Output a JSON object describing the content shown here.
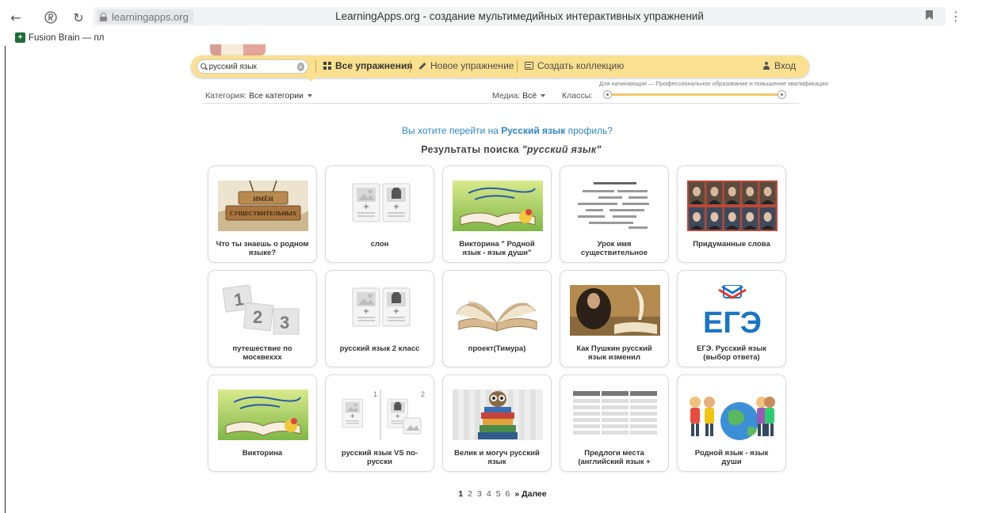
{
  "browser": {
    "url": "learningapps.org",
    "title": "LearningApps.org - создание мультимедийных интерактивных упражнений",
    "bookmark_label": "Fusion Brain — пл"
  },
  "header": {
    "search_value": "русский язык",
    "nav": {
      "all": "Все упражнения",
      "new": "Новое упражнение",
      "collection": "Создать коллекцию",
      "login": "Вход"
    }
  },
  "filters": {
    "category_label": "Категория:",
    "category_value": "Все категории",
    "media_label": "Медиа:",
    "media_value": "Всё",
    "grades_label": "Классы:",
    "slider_caption": "Для начинающих — Профессиональное образование и повышение квалификации"
  },
  "profile_prompt": {
    "before": "Вы хотите перейти на",
    "subject": "Русский язык",
    "after": "профиль?"
  },
  "results": {
    "prefix": "Результаты поиска",
    "query": "\"русский язык\""
  },
  "cards": [
    {
      "label": "Что ты знаешь о родном языке?",
      "thumb": "wood-sign",
      "sign_text": "ИМЁН СУЩЕСТВИТЕЛЬНЫХ"
    },
    {
      "label": "слон",
      "thumb": "placeholder"
    },
    {
      "label": "Викторина \" Родной язык - язык души\"",
      "thumb": "book-banner"
    },
    {
      "label": "Урок имя существительное",
      "thumb": "lines"
    },
    {
      "label": "Придуманные слова",
      "thumb": "portraits"
    },
    {
      "label": "путешествие по москвеххх",
      "thumb": "numbers"
    },
    {
      "label": "русский язык 2 класс",
      "thumb": "placeholder"
    },
    {
      "label": "проект(Тимура)",
      "thumb": "open-book"
    },
    {
      "label": "Как Пушкин русский язык изменил",
      "thumb": "quill"
    },
    {
      "label": "ЕГЭ. Русский язык (выбор ответа)",
      "thumb": "ege",
      "logo_text": "ЕГЭ"
    },
    {
      "label": "Викторина",
      "thumb": "book-banner"
    },
    {
      "label": "русский язык VS по-русски",
      "thumb": "pair"
    },
    {
      "label": "Велик и могуч русский язык",
      "thumb": "owl-books"
    },
    {
      "label": "Предлоги места (английский язык +",
      "thumb": "table"
    },
    {
      "label": "Родной язык - язык души",
      "thumb": "kids-globe"
    }
  ],
  "pagination": {
    "pages": [
      "1",
      "2",
      "3",
      "4",
      "5",
      "6"
    ],
    "current": "1",
    "next": "» Далее"
  },
  "colors": {
    "header_bar": "#fbe08f",
    "link_blue": "#2e87c7",
    "ege_blue": "#1a76c4",
    "ege_red": "#e03a2f"
  }
}
